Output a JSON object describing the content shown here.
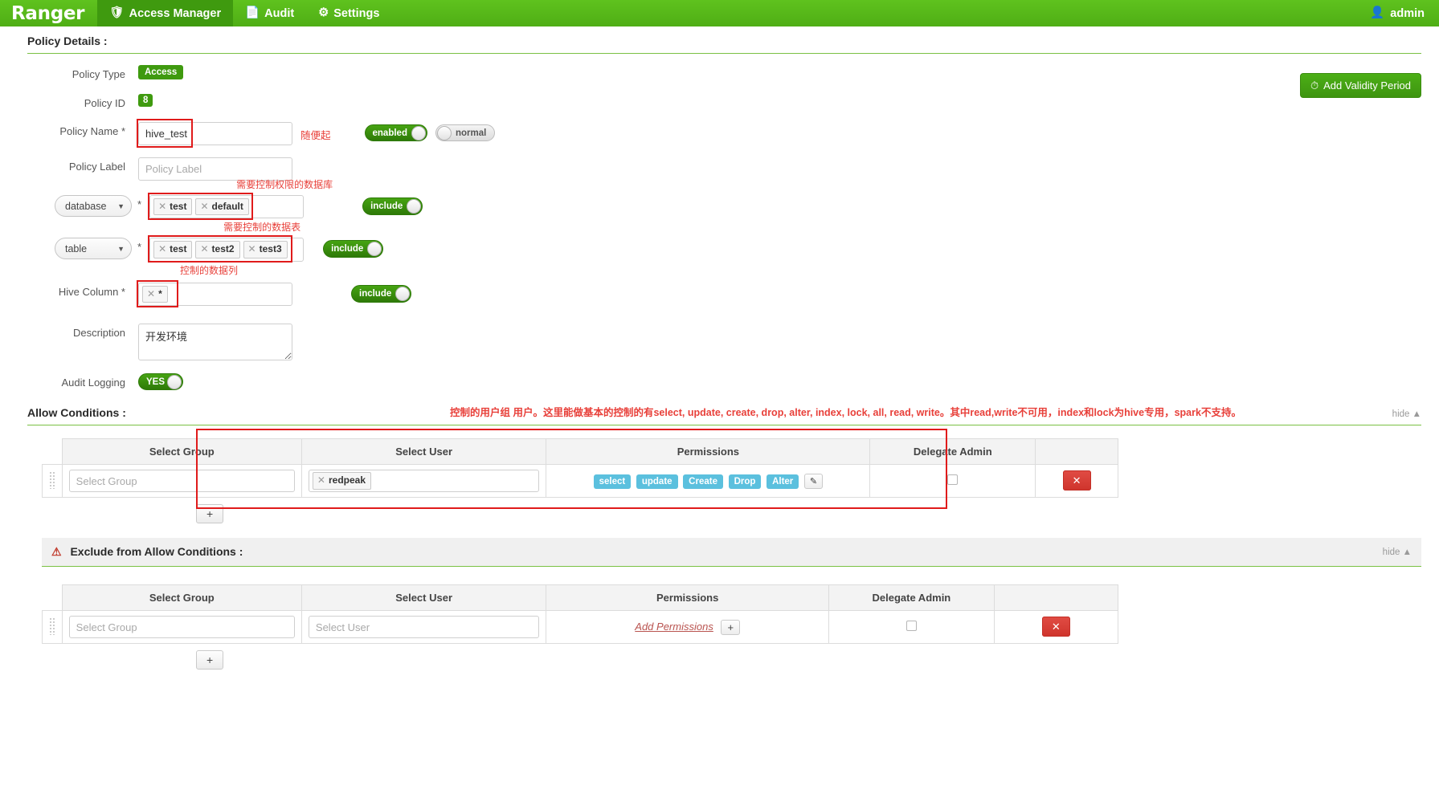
{
  "navbar": {
    "brand": "Ranger",
    "items": [
      {
        "label": "Access Manager",
        "icon": "shield-icon",
        "active": true
      },
      {
        "label": "Audit",
        "icon": "file-icon",
        "active": false
      },
      {
        "label": "Settings",
        "icon": "gear-icon",
        "active": false
      }
    ],
    "user": "admin",
    "user_icon": "user-icon"
  },
  "policy_details": {
    "heading": "Policy Details :",
    "add_validity_label": "Add Validity Period",
    "add_validity_icon": "clock-icon",
    "policy_type_label": "Policy Type",
    "policy_type_value": "Access",
    "policy_id_label": "Policy ID",
    "policy_id_value": "8",
    "policy_name_label": "Policy Name *",
    "policy_name_value": "hive_test",
    "policy_name_note": "随便起",
    "enabled_toggle": "enabled",
    "normal_toggle": "normal",
    "policy_label_label": "Policy Label",
    "policy_label_placeholder": "Policy Label",
    "description_label": "Description",
    "description_value": "开发环境",
    "audit_logging_label": "Audit Logging",
    "audit_logging_value": "YES",
    "include_label": "include"
  },
  "resources": [
    {
      "type": "database",
      "required": "*",
      "tags": [
        "test",
        "default"
      ],
      "annotation": "需要控制权限的数据库",
      "include": "include"
    },
    {
      "type": "table",
      "required": "*",
      "tags": [
        "test",
        "test2",
        "test3"
      ],
      "annotation": "需要控制的数据表",
      "include": "include"
    },
    {
      "type": "Hive Column *",
      "required": "",
      "tags": [
        "*"
      ],
      "annotation": "控制的数据列",
      "include": "include"
    }
  ],
  "allow_conditions": {
    "heading": "Allow Conditions :",
    "annotation": "控制的用户组 用户。这里能做基本的控制的有select, update, create, drop, alter, index, lock, all, read, write。其中read,write不可用，index和lock为hive专用，spark不支持。",
    "hide_label": "hide",
    "columns": [
      "Select Group",
      "Select User",
      "Permissions",
      "Delegate Admin"
    ],
    "rows": [
      {
        "group_placeholder": "Select Group",
        "group_value": "",
        "user_tags": [
          "redpeak"
        ],
        "permissions": [
          "select",
          "update",
          "Create",
          "Drop",
          "Alter"
        ],
        "edit_icon": "pencil-icon",
        "delegate_admin": false,
        "delete_icon": "close-icon"
      }
    ],
    "add_row_label": "+"
  },
  "exclude_conditions": {
    "heading": "Exclude from Allow Conditions :",
    "warn_icon": "warning-icon",
    "hide_label": "hide",
    "columns": [
      "Select Group",
      "Select User",
      "Permissions",
      "Delegate Admin"
    ],
    "rows": [
      {
        "group_placeholder": "Select Group",
        "user_placeholder": "Select User",
        "add_permissions_label": "Add Permissions",
        "add_permissions_plus": "+",
        "delegate_admin": false,
        "delete_icon": "close-icon"
      }
    ],
    "add_row_label": "+"
  },
  "colors": {
    "brand_green": "#5fc21e",
    "dark_green": "#3f9a0f",
    "annotation_red": "#e8403a",
    "perm_blue": "#5bc0de",
    "danger_red": "#cf352d"
  }
}
